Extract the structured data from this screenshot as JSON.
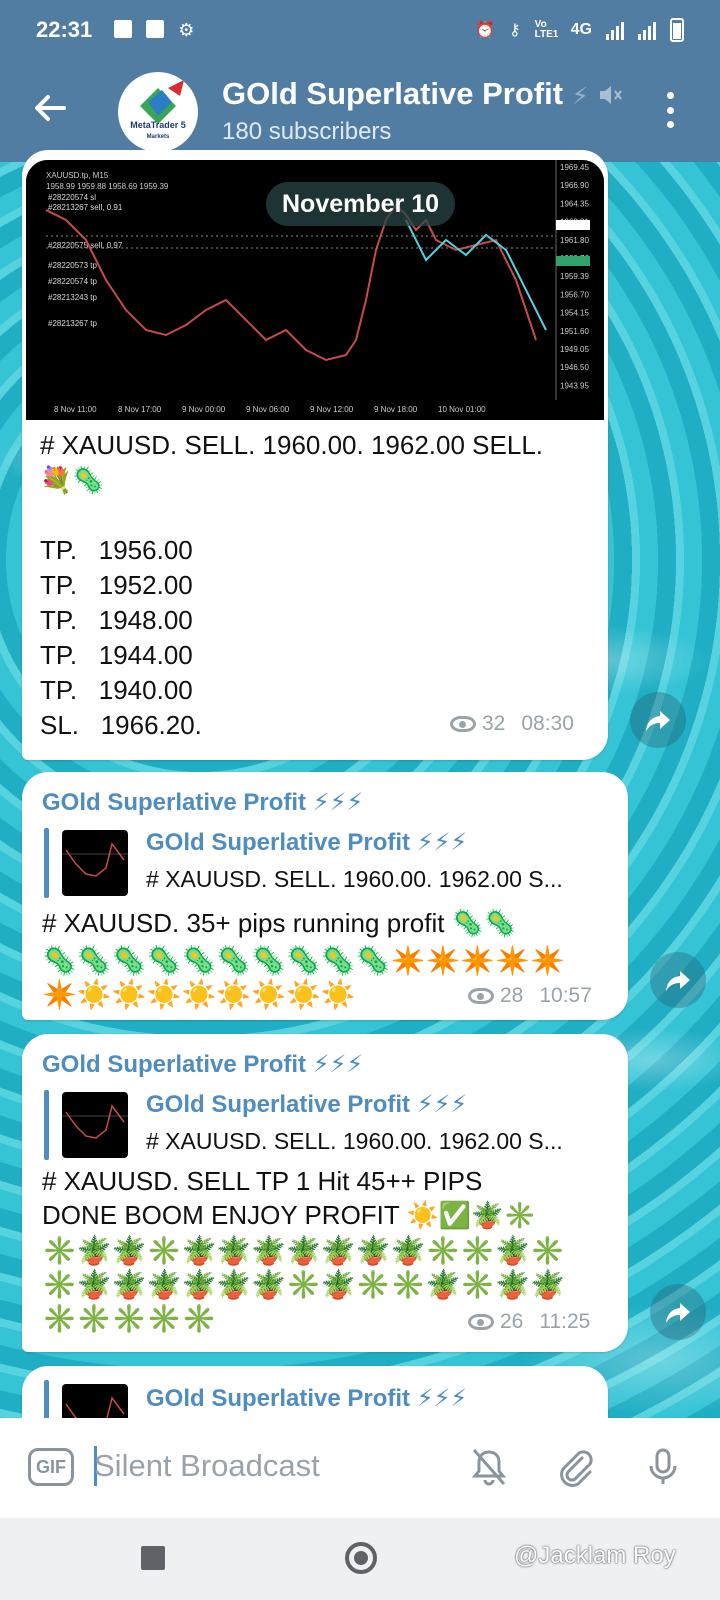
{
  "status": {
    "time": "22:31",
    "network": "4G",
    "volte": "Vo LTE1"
  },
  "header": {
    "title": "GOld Superlative Profit",
    "title_suffix": "⚡",
    "subtitle": "180 subscribers",
    "avatar_text": "MetaTrader 5",
    "avatar_subtext": "Markets"
  },
  "chart_thumb": {
    "symbol": "XAUUSD.tp, M15",
    "ohlc": "1958.99 1959.88 1958.69 1959.39",
    "orders": [
      "#28220574 sl",
      "#28213267 sell, 0.91",
      "#28220575 sell, 0.97",
      "#28220573 tp",
      "#28220574 tp",
      "#28213243 tp",
      "#28213267 tp"
    ],
    "price_labels": [
      "1969.45",
      "1966.90",
      "1964.35",
      "1963.31",
      "1961.80",
      "1960.76",
      "1959.39",
      "1956.70",
      "1954.15",
      "1951.60",
      "1949.05",
      "1946.50",
      "1943.95"
    ],
    "time_labels": [
      "8 Nov 11:00",
      "8 Nov 17:00",
      "9 Nov 00:00",
      "9 Nov 06:00",
      "9 Nov 12:00",
      "9 Nov 18:00",
      "10 Nov 01:00"
    ]
  },
  "date_pill": "November 10",
  "messages": [
    {
      "lines": [
        "# XAUUSD. SELL. 1960.00. 1962.00 SELL.",
        "💐🦠",
        "",
        "TP.   1956.00",
        "TP.   1952.00",
        "TP.   1948.00",
        "TP.   1944.00",
        "TP.   1940.00",
        "SL.   1966.20."
      ],
      "views": "32",
      "time": "08:30"
    },
    {
      "sender": "GOld Superlative Profit ⚡⚡⚡",
      "reply_title": "GOld Superlative Profit ⚡⚡⚡",
      "reply_text": "# XAUUSD. SELL. 1960.00. 1962.00 S...",
      "text_line": "# XAUUSD. 35+ pips running profit 🦠🦠",
      "emoji_rows": [
        "🦠🦠🦠🦠🦠🦠🦠🦠🦠🦠✴️✴️✴️✴️✴️",
        "✴️☀️☀️☀️☀️☀️☀️☀️☀️"
      ],
      "views": "28",
      "time": "10:57"
    },
    {
      "sender": "GOld Superlative Profit ⚡⚡⚡",
      "reply_title": "GOld Superlative Profit ⚡⚡⚡",
      "reply_text": "# XAUUSD. SELL. 1960.00. 1962.00 S...",
      "text_line_1": "# XAUUSD. SELL TP 1 Hit 45++ PIPS",
      "text_line_2": "DONE BOOM ENJOY PROFIT ☀️✅🪴✳️",
      "emoji_rows": [
        "✳️🪴🪴✳️🪴🪴🪴🪴🪴🪴🪴✳️✳️🪴✳️",
        "✳️🪴🪴🪴🪴🪴🪴✳️🪴✳️✳️🪴✳️🪴🪴",
        "✳️✳️✳️✳️✳️"
      ],
      "views": "26",
      "time": "11:25"
    },
    {
      "reply_title": "GOld Superlative Profit ⚡⚡⚡"
    }
  ],
  "composer": {
    "gif_label": "GIF",
    "placeholder": "Silent Broadcast"
  },
  "watermark": "@Jacklam Roy",
  "colors": {
    "header_bg": "#527da3",
    "accent": "#4f8cc0",
    "meta_gray": "#9aa3aa"
  }
}
